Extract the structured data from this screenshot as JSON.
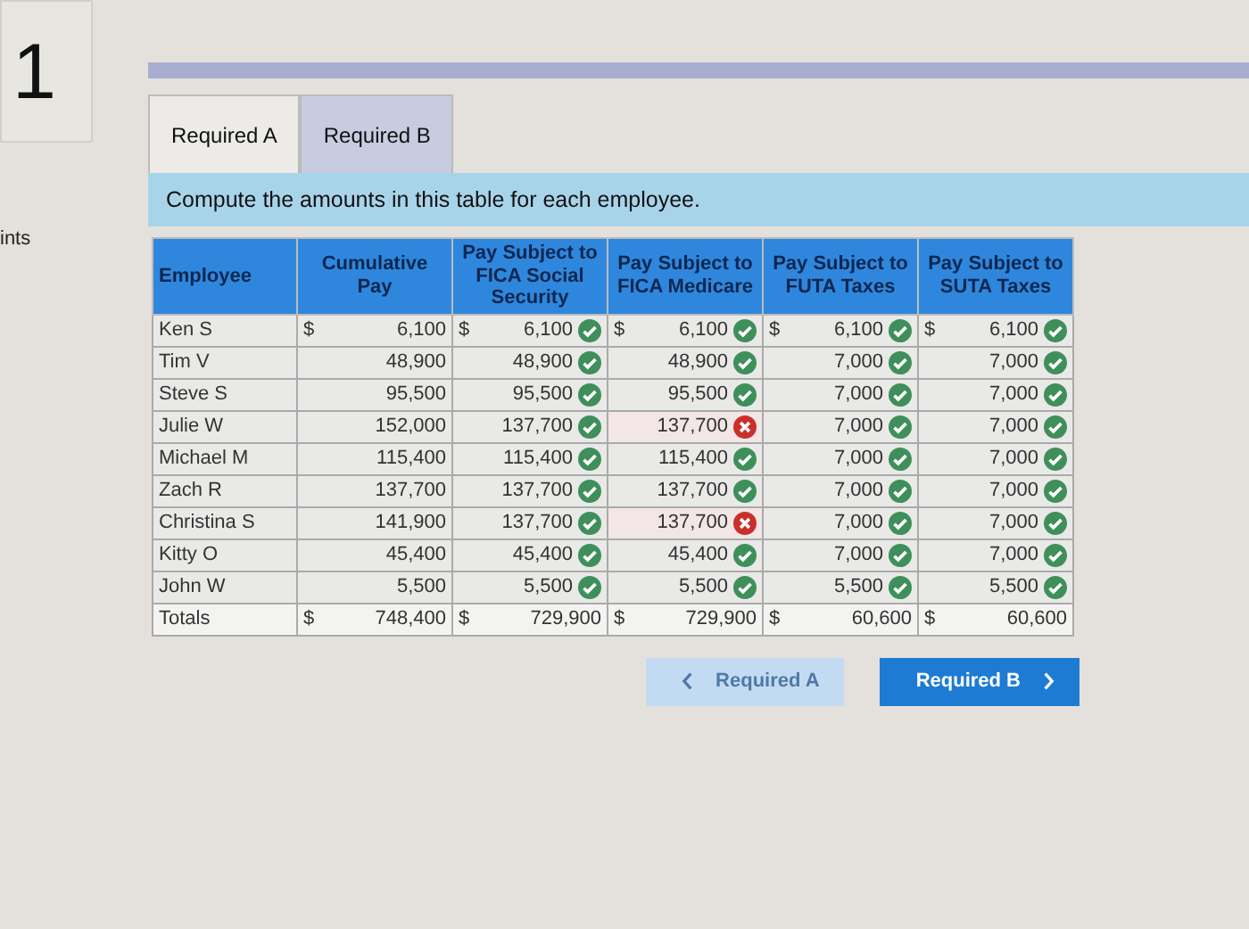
{
  "question_number": "1",
  "side_label": "ints",
  "tabs": [
    {
      "label": "Required A",
      "selected": true
    },
    {
      "label": "Required B",
      "selected": false
    }
  ],
  "instruction": "Compute the amounts in this table for each employee.",
  "table": {
    "columns": [
      "Employee",
      "Cumulative Pay",
      "Pay Subject to FICA Social Security",
      "Pay Subject to FICA Medicare",
      "Pay Subject to FUTA Taxes",
      "Pay Subject to SUTA Taxes"
    ],
    "rows": [
      {
        "cells": [
          {
            "value": "Ken S"
          },
          {
            "value": "6,100",
            "currency": "$"
          },
          {
            "value": "6,100",
            "currency": "$",
            "correct": true
          },
          {
            "value": "6,100",
            "currency": "$",
            "correct": true
          },
          {
            "value": "6,100",
            "currency": "$",
            "correct": true
          },
          {
            "value": "6,100",
            "currency": "$",
            "correct": true
          }
        ]
      },
      {
        "cells": [
          {
            "value": "Tim V"
          },
          {
            "value": "48,900"
          },
          {
            "value": "48,900",
            "correct": true
          },
          {
            "value": "48,900",
            "correct": true
          },
          {
            "value": "7,000",
            "correct": true
          },
          {
            "value": "7,000",
            "correct": true
          }
        ]
      },
      {
        "cells": [
          {
            "value": "Steve S"
          },
          {
            "value": "95,500"
          },
          {
            "value": "95,500",
            "correct": true
          },
          {
            "value": "95,500",
            "correct": true
          },
          {
            "value": "7,000",
            "correct": true
          },
          {
            "value": "7,000",
            "correct": true
          }
        ]
      },
      {
        "cells": [
          {
            "value": "Julie W"
          },
          {
            "value": "152,000"
          },
          {
            "value": "137,700",
            "correct": true
          },
          {
            "value": "137,700",
            "correct": false
          },
          {
            "value": "7,000",
            "correct": true
          },
          {
            "value": "7,000",
            "correct": true
          }
        ]
      },
      {
        "cells": [
          {
            "value": "Michael M"
          },
          {
            "value": "115,400"
          },
          {
            "value": "115,400",
            "correct": true
          },
          {
            "value": "115,400",
            "correct": true
          },
          {
            "value": "7,000",
            "correct": true
          },
          {
            "value": "7,000",
            "correct": true
          }
        ]
      },
      {
        "cells": [
          {
            "value": "Zach R"
          },
          {
            "value": "137,700"
          },
          {
            "value": "137,700",
            "correct": true
          },
          {
            "value": "137,700",
            "correct": true
          },
          {
            "value": "7,000",
            "correct": true
          },
          {
            "value": "7,000",
            "correct": true
          }
        ]
      },
      {
        "cells": [
          {
            "value": "Christina S"
          },
          {
            "value": "141,900"
          },
          {
            "value": "137,700",
            "correct": true
          },
          {
            "value": "137,700",
            "correct": false
          },
          {
            "value": "7,000",
            "correct": true
          },
          {
            "value": "7,000",
            "correct": true
          }
        ]
      },
      {
        "cells": [
          {
            "value": "Kitty O"
          },
          {
            "value": "45,400"
          },
          {
            "value": "45,400",
            "correct": true
          },
          {
            "value": "45,400",
            "correct": true
          },
          {
            "value": "7,000",
            "correct": true
          },
          {
            "value": "7,000",
            "correct": true
          }
        ]
      },
      {
        "cells": [
          {
            "value": "John W"
          },
          {
            "value": "5,500"
          },
          {
            "value": "5,500",
            "correct": true
          },
          {
            "value": "5,500",
            "correct": true
          },
          {
            "value": "5,500",
            "correct": true
          },
          {
            "value": "5,500",
            "correct": true
          }
        ]
      },
      {
        "cells": [
          {
            "value": "Totals"
          },
          {
            "value": "748,400",
            "currency": "$"
          },
          {
            "value": "729,900",
            "currency": "$"
          },
          {
            "value": "729,900",
            "currency": "$"
          },
          {
            "value": "60,600",
            "currency": "$"
          },
          {
            "value": "60,600",
            "currency": "$"
          }
        ]
      }
    ]
  },
  "nav_buttons": [
    {
      "label": "Required A",
      "kind": "prev",
      "disabled": true
    },
    {
      "label": "Required B",
      "kind": "next",
      "disabled": false
    }
  ]
}
